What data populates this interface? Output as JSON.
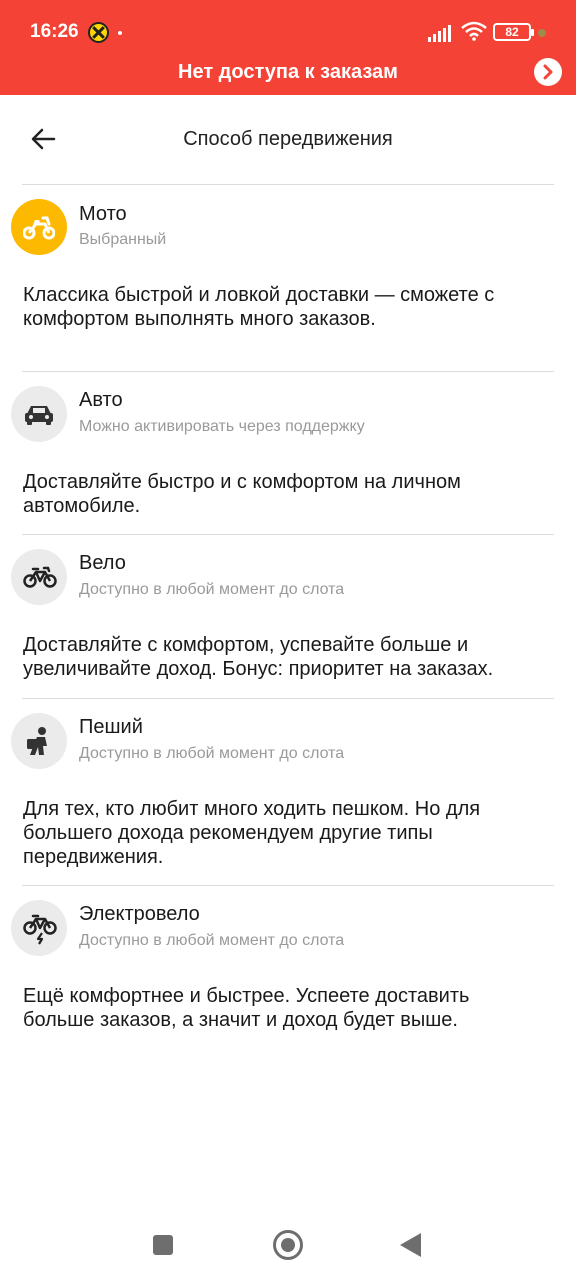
{
  "status_bar": {
    "time": "16:26",
    "battery": "82",
    "icons": [
      "app-notification-icon",
      "signal-icon",
      "wifi-icon",
      "battery-icon"
    ]
  },
  "banner": {
    "text": "Нет доступа к заказам",
    "color": "#f44336"
  },
  "header": {
    "title": "Способ передвижения"
  },
  "colors": {
    "accent": "#fcb900",
    "icon_bg": "#ebebeb"
  },
  "options": [
    {
      "name": "Мото",
      "status": "Выбранный",
      "description": "Классика быстрой и ловкой доставки — сможете с комфортом выполнять много заказов.",
      "icon": "motorcycle-icon",
      "selected": true
    },
    {
      "name": "Авто",
      "status": "Можно активировать через поддержку",
      "description": "Доставляйте быстро и с комфортом на личном автомобиле.",
      "icon": "car-icon",
      "selected": false
    },
    {
      "name": "Вело",
      "status": "Доступно в любой момент до слота",
      "description": "Доставляйте с комфортом, успевайте больше и увеличивайте доход. Бонус: приоритет на заказах.",
      "icon": "bicycle-icon",
      "selected": false
    },
    {
      "name": "Пеший",
      "status": "Доступно в любой момент до слота",
      "description": "Для тех, кто любит много ходить пешком. Но для большего дохода рекомендуем другие типы передвижения.",
      "icon": "walking-courier-icon",
      "selected": false
    },
    {
      "name": "Электровело",
      "status": "Доступно в любой момент до слота",
      "description": "Ещё комфортнее и быстрее. Успеете доставить больше заказов, а значит и доход будет выше.",
      "icon": "electric-bicycle-icon",
      "selected": false
    }
  ],
  "nav_bar": {
    "icons": [
      "recent-apps-icon",
      "home-icon",
      "back-icon"
    ]
  }
}
